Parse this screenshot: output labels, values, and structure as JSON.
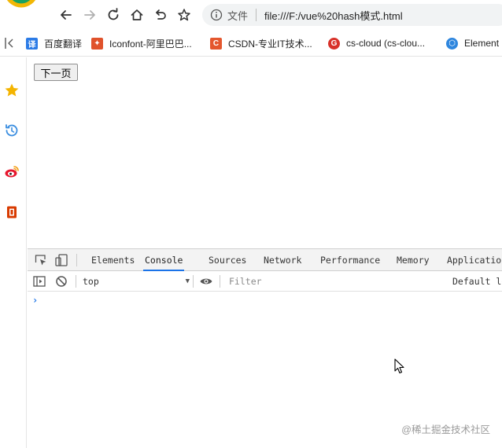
{
  "browser": {
    "address": {
      "scheme_label": "文件",
      "url": "file:///F:/vue%20hash模式.html"
    }
  },
  "bookmarks": [
    {
      "label": "百度翻译",
      "icon": "translate-icon",
      "icon_glyph": "译",
      "color": "#2b7be6"
    },
    {
      "label": "Iconfont-阿里巴巴...",
      "icon": "iconfont-icon",
      "icon_glyph": "✦",
      "color": "#e0522b"
    },
    {
      "label": "CSDN-专业IT技术...",
      "icon": "csdn-icon",
      "icon_glyph": "C",
      "color": "#e4572e"
    },
    {
      "label": "cs-cloud (cs-clou...",
      "icon": "cs-cloud-icon",
      "icon_glyph": "G",
      "color": "#d8322a"
    },
    {
      "label": "Element",
      "icon": "element-icon",
      "icon_glyph": "⬡",
      "color": "#2e86de"
    }
  ],
  "page": {
    "next_button": "下一页"
  },
  "devtools": {
    "tabs": [
      "Elements",
      "Console",
      "Sources",
      "Network",
      "Performance",
      "Memory",
      "Applicatio"
    ],
    "active_tab": "Console",
    "context": "top",
    "filter_placeholder": "Filter",
    "levels_label": "Default le",
    "prompt_symbol": "›"
  },
  "watermark": "@稀土掘金技术社区",
  "colors": {
    "accent": "#1a73e8",
    "star": "#f4b400",
    "history": "#3b8ee0",
    "weibo": "#e6162d",
    "office": "#d83b01"
  }
}
